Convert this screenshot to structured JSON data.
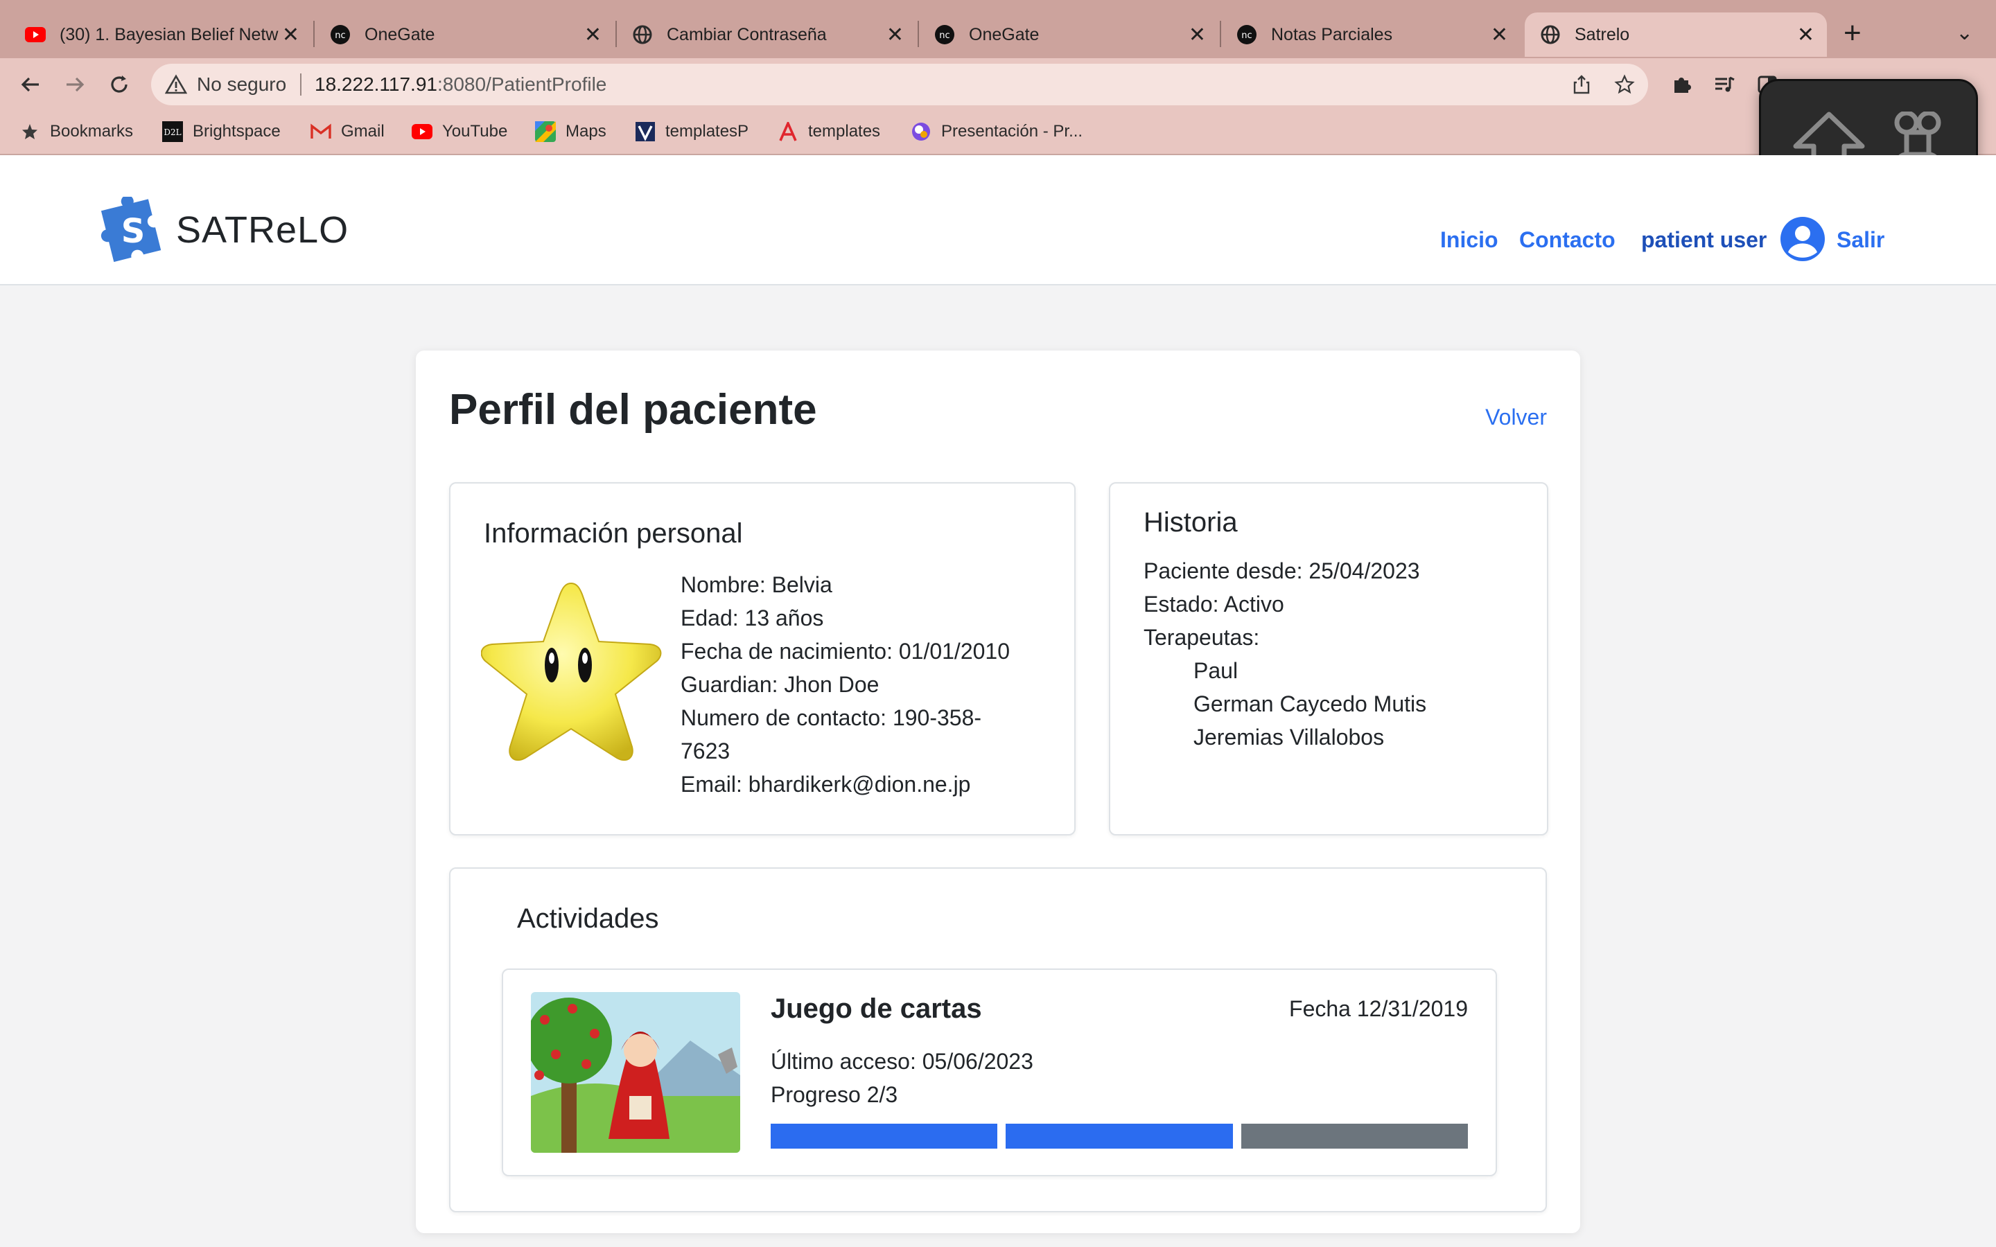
{
  "browser": {
    "tabs": [
      {
        "title": "(30) 1. Bayesian Belief Netw",
        "icon": "youtube-icon"
      },
      {
        "title": "OneGate",
        "icon": "onegate-icon"
      },
      {
        "title": "Cambiar Contraseña",
        "icon": "globe-icon"
      },
      {
        "title": "OneGate",
        "icon": "onegate-icon"
      },
      {
        "title": "Notas Parciales",
        "icon": "onegate-icon"
      },
      {
        "title": "Satrelo",
        "icon": "globe-icon",
        "active": true
      }
    ],
    "insecure_label": "No seguro",
    "url_host": "18.222.117.91",
    "url_rest": ":8080/PatientProfile",
    "bookmarks": [
      {
        "label": "Bookmarks",
        "icon": "star-icon"
      },
      {
        "label": "Brightspace",
        "icon": "d2l-icon"
      },
      {
        "label": "Gmail",
        "icon": "gmail-icon"
      },
      {
        "label": "YouTube",
        "icon": "youtube-icon"
      },
      {
        "label": "Maps",
        "icon": "maps-icon"
      },
      {
        "label": "templatesP",
        "icon": "templates-icon"
      },
      {
        "label": "templates",
        "icon": "templates-a-icon"
      },
      {
        "label": "Presentación - Pr...",
        "icon": "presentation-icon"
      }
    ]
  },
  "site": {
    "brand": "SATReLO",
    "nav": {
      "home": "Inicio",
      "contact": "Contacto",
      "user": "patient user",
      "logout": "Salir"
    }
  },
  "profile": {
    "title": "Perfil del paciente",
    "back": "Volver",
    "personal": {
      "heading": "Información personal",
      "name": "Nombre: Belvia",
      "age": "Edad: 13 años",
      "birth": "Fecha de nacimiento: 01/01/2010",
      "guardian": "Guardian: Jhon Doe",
      "contact_1": "Numero de contacto: 190-358-",
      "contact_2": "7623",
      "email": "Email: bhardikerk@dion.ne.jp"
    },
    "history": {
      "heading": "Historia",
      "since": "Paciente desde: 25/04/2023",
      "status": "Estado: Activo",
      "therapists_label": "Terapeutas:",
      "therapists": [
        "Paul",
        "German Caycedo Mutis",
        "Jeremias Villalobos"
      ]
    },
    "activities": {
      "heading": "Actividades",
      "items": [
        {
          "title": "Juego de cartas",
          "date": "Fecha 12/31/2019",
          "last_access": "Último acceso: 05/06/2023",
          "progress_text": "Progreso 2/3",
          "progress_done": 2,
          "progress_total": 3
        }
      ]
    }
  },
  "colors": {
    "accent": "#2b6ff0",
    "progress_done": "#2b6cf0",
    "progress_todo": "#6c757d",
    "chrome_tabstrip": "#cca39d",
    "chrome_toolbar": "#e8c6c1"
  }
}
